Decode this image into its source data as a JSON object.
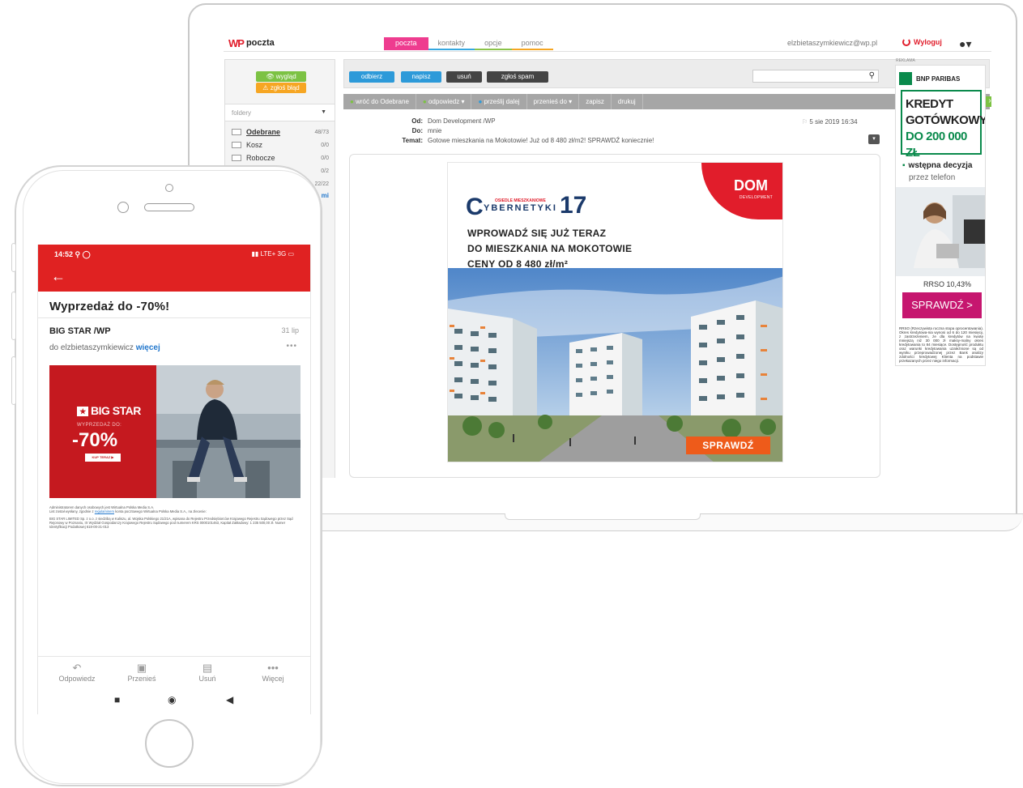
{
  "laptop": {
    "topbar": {
      "logo_text": "poczta",
      "nav": [
        "poczta",
        "kontakty",
        "opcje",
        "pomoc"
      ],
      "user": "elzbietaszymkiewicz@wp.pl",
      "logout": "Wyloguj"
    },
    "left": {
      "look_btn": "wygląd",
      "report_btn": "zgłoś błąd",
      "folders_label": "foldery",
      "folders": [
        {
          "name": "Odebrane",
          "count": "48/73"
        },
        {
          "name": "Kosz",
          "count": "0/0"
        },
        {
          "name": "Robocze",
          "count": "0/0"
        },
        {
          "name": "",
          "count": "0/2"
        },
        {
          "name": "",
          "count": "22/22"
        }
      ],
      "folders_more": "mi"
    },
    "toolbar": {
      "receive": "odbierz",
      "compose": "napisz",
      "delete": "usuń",
      "spam": "zgłoś spam"
    },
    "actions": {
      "back": "wróć do Odebrane",
      "reply": "odpowiedz",
      "forward": "prześlij dalej",
      "move": "przenieś do",
      "save": "zapisz",
      "print": "drukuj"
    },
    "message": {
      "from_label": "Od:",
      "from": "Dom Development /WP",
      "to_label": "Do:",
      "to": "mnie",
      "subject_label": "Temat:",
      "subject": "Gotowe mieszkania na Mokotowie! Już od 8 480 zł/m2! SPRAWDŹ koniecznie!",
      "date": "5 sie 2019 16:34"
    },
    "ad": {
      "brand": "DOM",
      "brand_sub": "DEVELOPMENT",
      "estate_small": "OSIEDLE MIESZKANIOWE",
      "estate_name": "YBERNETYKI",
      "estate_c": "C",
      "estate_number": "17",
      "line1": "WPROWADŹ SIĘ JUŻ TERAZ",
      "line2": "DO MIESZKANIA NA MOKOTOWIE",
      "line3": "CENY OD 8 480 zł/m²",
      "cta": "SPRAWDŹ"
    },
    "side_ad": {
      "label": "REKLAMA",
      "bank": "BNP PARIBAS",
      "k1": "KREDYT",
      "k2": "GOTÓWKOWY",
      "k3": "DO 200 000 ZŁ",
      "bullet": "wstępna decyzja",
      "sub": "przez telefon",
      "rrso": "RRSO 10,43%",
      "cta": "SPRAWDŹ >",
      "fine": "RRSO (Rzeczywista roczna stopa oprocentowania). Okres kredytowa-nia wynosi od 6 do 120 miesięcy, z zastrzeżeniem, że dla kredytów na kwotę mniejszą niż 30 000 zł maksy-malny okres kredytowania to 84 miesiące. Dostępność produktu oraz warunki kredytowania uzależnione są od wyniku przeprowadzonej przez Bank analizy zdolności kredytowej Klienta na podstawie przekazanych przez niego informacji."
    }
  },
  "phone": {
    "time": "14:52",
    "status_right": "LTE+ 3G",
    "subject": "Wyprzedaż do -70%!",
    "sender": "BIG STAR /WP",
    "date": "31 lip",
    "to_prefix": "do elzbietaszymkiewicz",
    "more": "więcej",
    "banner": {
      "logo": "BIG STAR",
      "sale_label": "WYPRZEDAŻ DO:",
      "discount": "-70%",
      "buy": "KUP TERAZ"
    },
    "fine1": "Administratorem danych osobowych jest Wirtualna Polska Media S.A.",
    "fine2a": "List został wysłany, zgodnie z",
    "fine2_link": "regulaminem",
    "fine2b": "konta pocztowego Wirtualna Polska Media S.A., na zlecenie:",
    "fine3": "BIG STAR LIMITED Sp. z o.o. z siedzibą w Kaliszu, al. Wojska Polskiego 21/21A, wpisana do Rejestru Przedsiębiorców Krajowego Rejestru Sądowego przez Sąd Rejonowy w Poznaniu, IX Wydział Gospodarczy Krajowego Rejestru Sądowego pod numerem KRS 0000101463, Kapitał Zakładowy: 1 235 500,00 zł. Numer Identyfikacji Podatkowej 618-00-21-013",
    "actions": [
      "Odpowiedz",
      "Przenieś",
      "Usuń",
      "Więcej"
    ]
  }
}
